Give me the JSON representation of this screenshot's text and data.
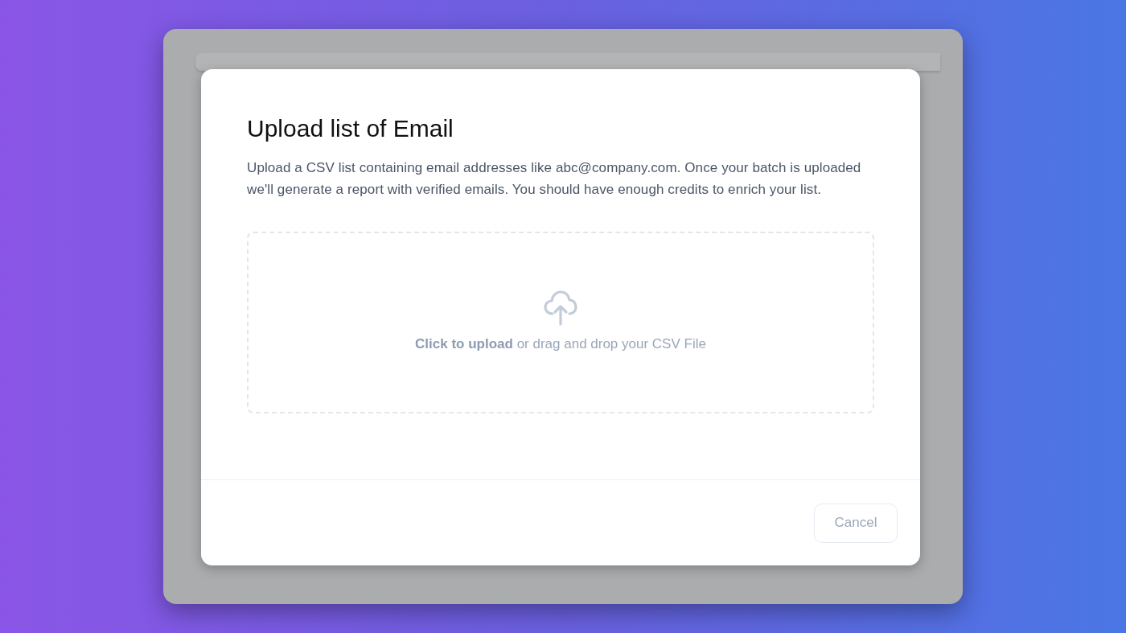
{
  "dialog": {
    "title": "Upload list of Email",
    "description": "Upload a CSV list containing email addresses like abc@company.com. Once your batch is uploaded we'll generate a report with verified emails. You should have enough credits to enrich your list.",
    "dropzone": {
      "text": "**Click to upload** or drag and drop your CSV File"
    },
    "buttons": [
      {
        "label": "Cancel"
      }
    ]
  }
}
